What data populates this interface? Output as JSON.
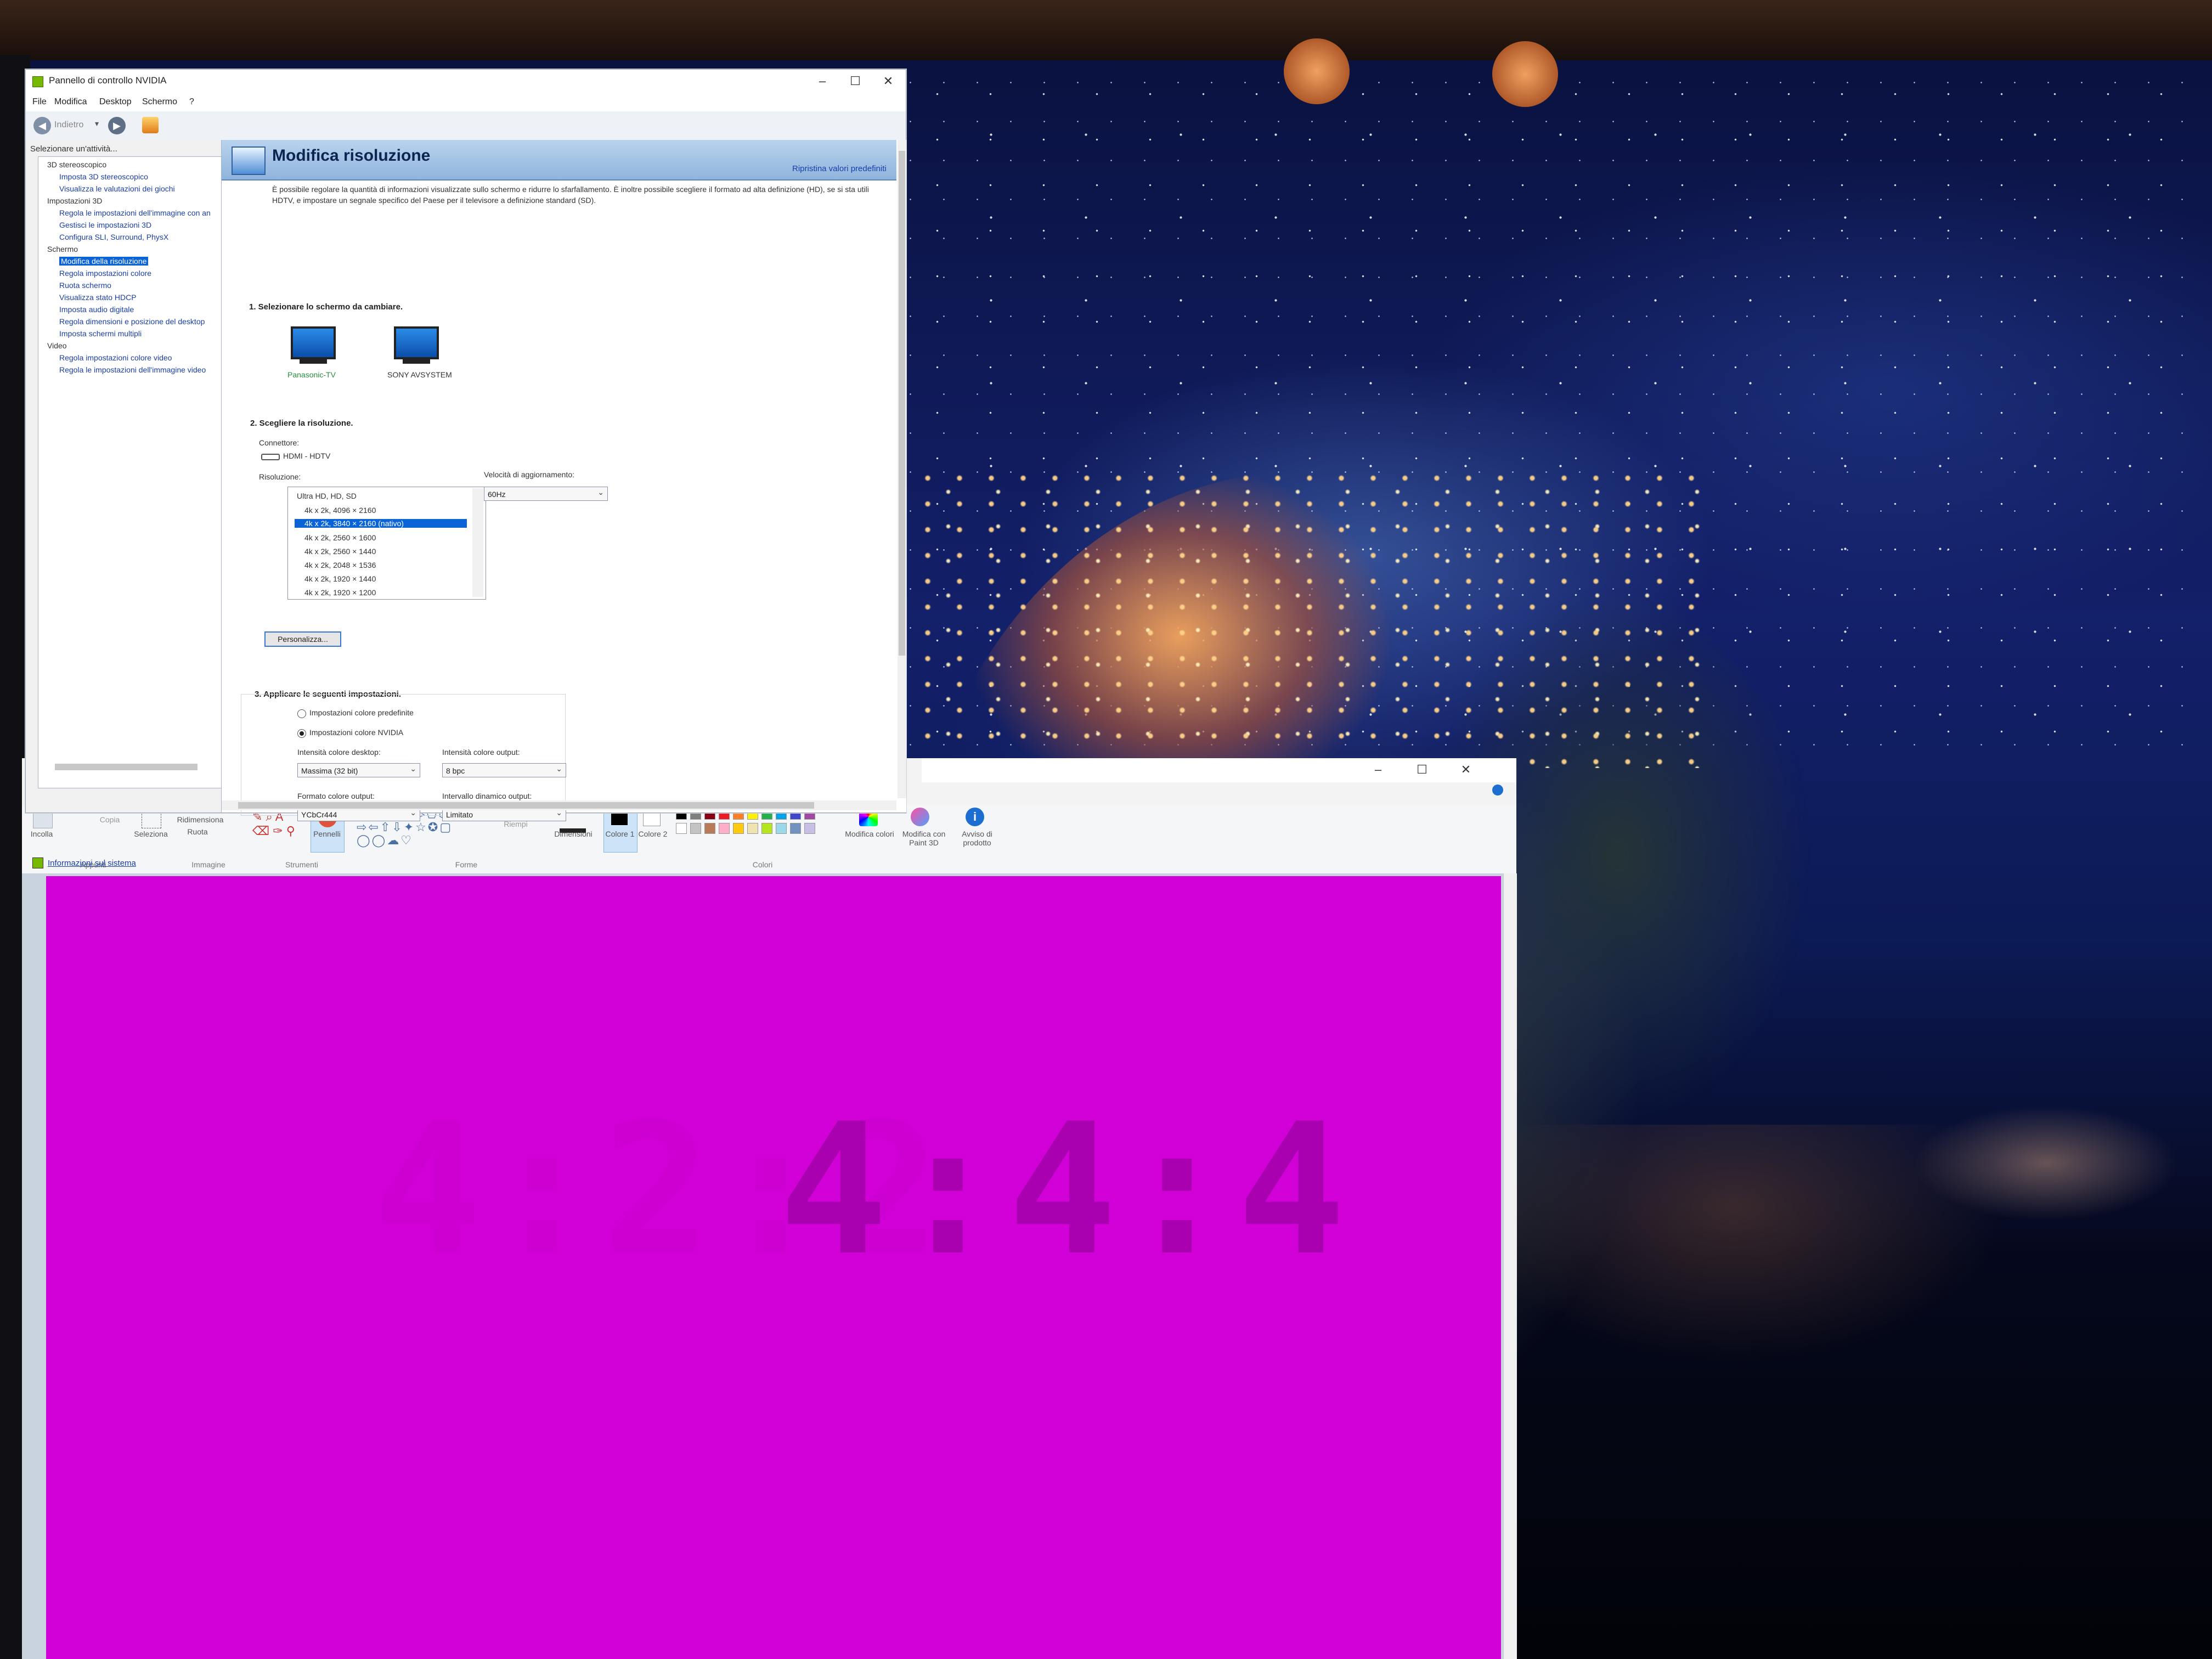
{
  "nvidia": {
    "title": "Pannello di controllo NVIDIA",
    "menu": [
      "File",
      "Modifica",
      "Desktop",
      "Schermo",
      "?"
    ],
    "toolbar": {
      "back_label": "Indietro"
    },
    "task_header": "Selezionare un'attività...",
    "tree": [
      {
        "label": "3D stereoscopico",
        "level": 0
      },
      {
        "label": "Imposta 3D stereoscopico",
        "level": 1
      },
      {
        "label": "Visualizza le valutazioni dei giochi",
        "level": 1
      },
      {
        "label": "Impostazioni 3D",
        "level": 0
      },
      {
        "label": "Regola le impostazioni dell'immagine con an",
        "level": 1
      },
      {
        "label": "Gestisci le impostazioni 3D",
        "level": 1
      },
      {
        "label": "Configura SLI, Surround, PhysX",
        "level": 1
      },
      {
        "label": "Schermo",
        "level": 0
      },
      {
        "label": "Modifica della risoluzione",
        "level": 1,
        "selected": true
      },
      {
        "label": "Regola impostazioni colore",
        "level": 1
      },
      {
        "label": "Ruota schermo",
        "level": 1
      },
      {
        "label": "Visualizza stato HDCP",
        "level": 1
      },
      {
        "label": "Imposta audio digitale",
        "level": 1
      },
      {
        "label": "Regola dimensioni e posizione del desktop",
        "level": 1
      },
      {
        "label": "Imposta schermi multipli",
        "level": 1
      },
      {
        "label": "Video",
        "level": 0
      },
      {
        "label": "Regola impostazioni colore video",
        "level": 1
      },
      {
        "label": "Regola le impostazioni dell'immagine video",
        "level": 1
      }
    ],
    "system_info": "Informazioni sul sistema",
    "page": {
      "title": "Modifica risoluzione",
      "restore": "Ripristina valori predefiniti",
      "description": "È possibile regolare la quantità di informazioni visualizzate sullo schermo e ridurre lo sfarfallamento. È inoltre possibile scegliere il formato ad alta definizione (HD), se si sta utili HDTV, e impostare un segnale specifico del Paese per il televisore a definizione standard (SD).",
      "step1": "1. Selezionare lo schermo da cambiare.",
      "displays": [
        "Panasonic-TV",
        "SONY AVSYSTEM"
      ],
      "step2": "2. Scegliere la risoluzione.",
      "connector_label": "Connettore:",
      "connector_value": "HDMI - HDTV",
      "resolution_label": "Risoluzione:",
      "resolution_group": "Ultra HD, HD, SD",
      "resolutions": [
        {
          "label": "4k x 2k, 4096 × 2160"
        },
        {
          "label": "4k x 2k, 3840 × 2160 (nativo)",
          "selected": true
        },
        {
          "label": "4k x 2k, 2560 × 1600"
        },
        {
          "label": "4k x 2k, 2560 × 1440"
        },
        {
          "label": "4k x 2k, 2048 × 1536"
        },
        {
          "label": "4k x 2k, 1920 × 1440"
        },
        {
          "label": "4k x 2k, 1920 × 1200"
        }
      ],
      "refresh_label": "Velocità di aggiornamento:",
      "refresh_value": "60Hz",
      "customize_button": "Personalizza...",
      "step3": "3. Applicare le seguenti impostazioni.",
      "radio_default": "Impostazioni colore predefinite",
      "radio_nvidia": "Impostazioni colore NVIDIA",
      "desktop_depth_label": "Intensità colore desktop:",
      "desktop_depth_value": "Massima (32 bit)",
      "output_depth_label": "Intensità colore output:",
      "output_depth_value": "8 bpc",
      "output_format_label": "Formato colore output:",
      "output_format_value": "YCbCr444",
      "dynamic_range_label": "Intervallo dinamico output:",
      "dynamic_range_value": "Limitato"
    }
  },
  "paint": {
    "ribbon": {
      "paste": "Incolla",
      "copy": "Copia",
      "select": "Seleziona",
      "resize": "Ridimensiona",
      "rotate": "Ruota",
      "brushes": "Pennelli",
      "fill": "Riempi",
      "size": "Dimensioni",
      "color1": "Colore 1",
      "color2": "Colore 2",
      "edit_colors": "Modifica colori",
      "paint3d": "Modifica con Paint 3D",
      "product_alert": "Avviso di prodotto"
    },
    "groups": [
      "Appunti",
      "Immagine",
      "Strumenti",
      "Forme",
      "Colori"
    ],
    "canvas_text": "4:4:4",
    "canvas_color": "#d100d6",
    "palette": [
      "#000000",
      "#7f7f7f",
      "#880015",
      "#ed1c24",
      "#ff7f27",
      "#fff200",
      "#22b14c",
      "#00a2e8",
      "#3f48cc",
      "#a349a4",
      "#ffffff",
      "#c3c3c3",
      "#b97a57",
      "#ffaec9",
      "#ffc90e",
      "#efe4b0",
      "#b5e61d",
      "#99d9ea",
      "#7092be",
      "#c8bfe7"
    ]
  }
}
